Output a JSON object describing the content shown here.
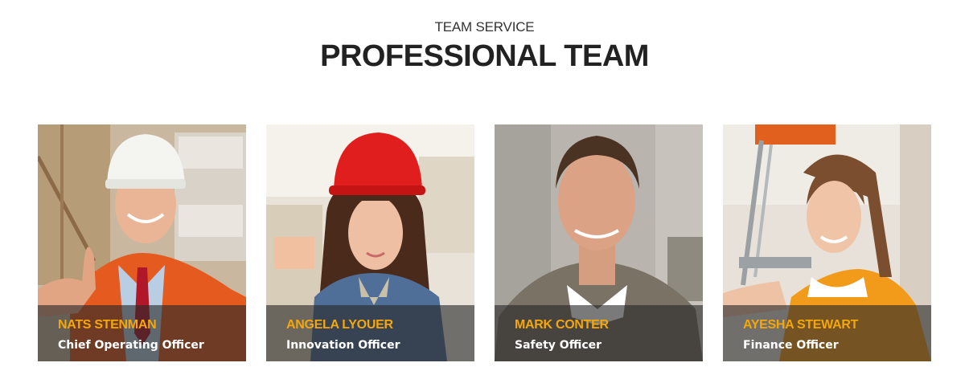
{
  "header": {
    "kicker": "TEAM SERVICE",
    "title": "PROFESSIONAL TEAM"
  },
  "team": [
    {
      "name": "NATS STENMAN",
      "role": "Chief Operating Officer"
    },
    {
      "name": "ANGELA LYOUER",
      "role": "Innovation Officer"
    },
    {
      "name": "MARK CONTER",
      "role": "Safety Officer"
    },
    {
      "name": "AYESHA STEWART",
      "role": "Finance Officer"
    }
  ],
  "colors": {
    "name_accent": "#f5a70a",
    "caption_overlay": "#282828",
    "heading_text": "#222222"
  }
}
